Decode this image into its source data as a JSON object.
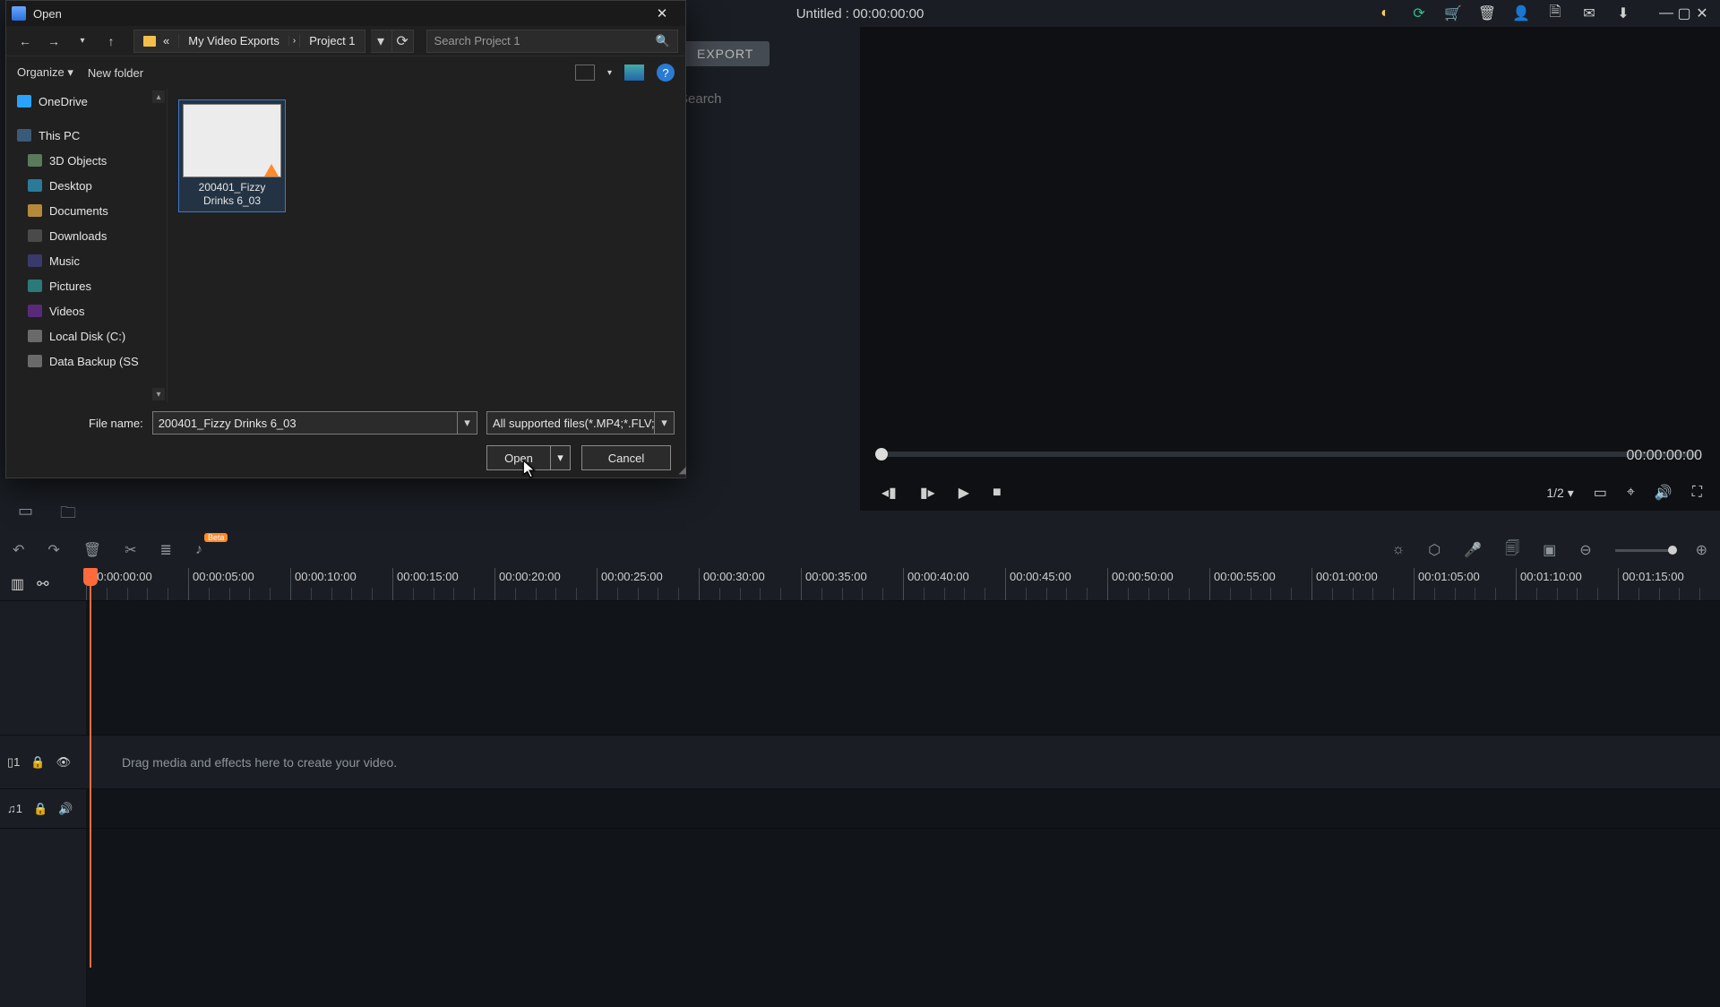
{
  "app": {
    "title": "Untitled : 00:00:00:00",
    "export_label": "EXPORT",
    "search_placeholder": "Search"
  },
  "preview": {
    "time": "00:00:00:00",
    "ratio": "1/2"
  },
  "timeline": {
    "hint": "Drag media and effects here to create your video.",
    "marks": [
      "00:00:00:00",
      "00:00:05:00",
      "00:00:10:00",
      "00:00:15:00",
      "00:00:20:00",
      "00:00:25:00",
      "00:00:30:00",
      "00:00:35:00",
      "00:00:40:00",
      "00:00:45:00",
      "00:00:50:00",
      "00:00:55:00",
      "00:01:00:00",
      "00:01:05:00",
      "00:01:10:00",
      "00:01:15:00"
    ],
    "track_video_label": "▯1",
    "track_audio_label": "♫1"
  },
  "dialog": {
    "title": "Open",
    "breadcrumb_prefix": "«",
    "breadcrumb": [
      "My Video Exports",
      "Project 1"
    ],
    "search_placeholder": "Search Project 1",
    "organize": "Organize",
    "new_folder": "New folder",
    "tree": {
      "onedrive": "OneDrive",
      "thispc": "This PC",
      "items": [
        "3D Objects",
        "Desktop",
        "Documents",
        "Downloads",
        "Music",
        "Pictures",
        "Videos",
        "Local Disk (C:)",
        "Data Backup (SS"
      ]
    },
    "file": {
      "name_line1": "200401_Fizzy",
      "name_line2": "Drinks 6_03"
    },
    "file_name_label": "File name:",
    "file_name_value": "200401_Fizzy Drinks 6_03",
    "file_type_value": "All supported files(*.MP4;*.FLV;",
    "open_label": "Open",
    "cancel_label": "Cancel"
  }
}
